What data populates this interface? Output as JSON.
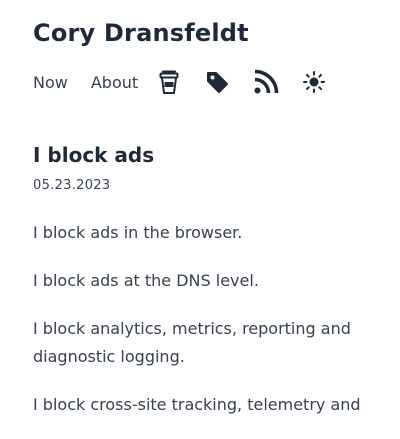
{
  "site": {
    "title": "Cory Dransfeldt"
  },
  "nav": {
    "items": [
      {
        "label": "Now"
      },
      {
        "label": "About"
      }
    ],
    "icons": [
      "coffee-cup-icon",
      "tag-icon",
      "rss-icon",
      "sun-icon"
    ]
  },
  "post": {
    "title": "I block ads",
    "date": "05.23.2023",
    "paragraphs": [
      "I block ads in the browser.",
      "I block ads at the DNS level.",
      "I block analytics, metrics, reporting and diagnostic logging.",
      "I block cross-site tracking, telemetry and"
    ]
  },
  "colors": {
    "text": "#1f2937",
    "muted": "#374151",
    "background": "#ffffff"
  }
}
